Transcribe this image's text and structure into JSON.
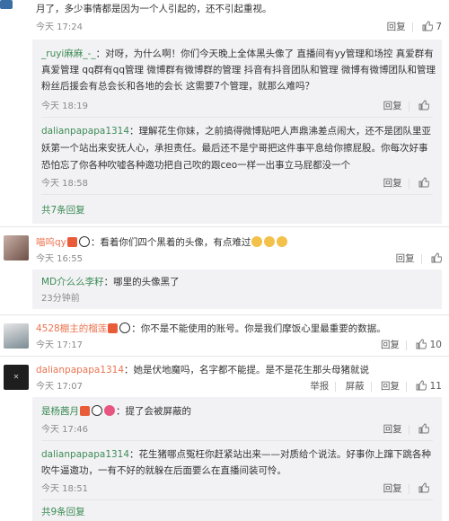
{
  "block1": {
    "text": "月了，多少事情都是因为一个人引起的，还不引起重视。",
    "time": "今天 17:24",
    "reply": "回复",
    "likes": "7"
  },
  "sub1": {
    "user": "_ruyi麻麻_-_",
    "lines": [
      "：对呀，为什么啊！你们今天晚上全体黑头像了 直播间有yy管理和场控 真爱群有",
      "真爱管理 qq群有qq管理 微博群有微博群的管理 抖音有抖音团队和管理 微博有微博团队和管理",
      "粉丝后援会有总会长和各地的会长 这需要7个管理，就那么难吗？"
    ],
    "time": "今天 18:19",
    "reply": "回复"
  },
  "sub2": {
    "user": "dalianpapapa1314",
    "lines": [
      "：理解花生你妹，之前搞得微博贴吧人声鼎沸差点闹大，还不是团队里亚",
      "妖第一个站出来安抚人心，承担责任。最后还不是宁哥把这件事平息给你擦屁股。你每次好事",
      "恐怕忘了你各种吹嘘各种邀功把自己吹的跟ceo一样一出事立马屁都没一个"
    ],
    "time": "今天 18:58",
    "reply": "回复"
  },
  "more1": "共7条回复",
  "block2": {
    "user": "喵呜qy",
    "text": "：看着你们四个黑着的头像，有点难过",
    "time": "今天 16:55",
    "reply": "回复",
    "sub_user": "MD介么么李籽",
    "sub_text": "：哪里的头像黑了",
    "sub_time": "23分钟前"
  },
  "block3": {
    "user": "4528棚主的榴莲",
    "text": "：你不是不能使用的账号。你是我们摩饭心里最重要的数据。",
    "time": "今天 17:17",
    "reply": "回复",
    "likes": "10"
  },
  "block4": {
    "user": "dalianpapapa1314",
    "text": "：她是伏地魔吗，名字都不能提。是不是花生那头母猪就说",
    "time": "今天 17:07",
    "report": "举报",
    "block": "屏蔽",
    "reply": "回复",
    "likes": "11",
    "sub1_user": "是杨茜月",
    "sub1_text": "：提了会被屏蔽的",
    "sub1_time": "今天 17:46",
    "sub1_reply": "回复",
    "sub2_user": "dalianpapapa1314",
    "sub2_lines": [
      "：花生猪哪点冤枉你赶紧站出来——对质给个说法。好事你上蹿下跳各种",
      "吹牛逼邀功，一有不好的就躲在后面要么在直播间装可怜。"
    ],
    "sub2_time": "今天 18:51",
    "sub2_reply": "回复"
  },
  "more2": "共9条回复"
}
